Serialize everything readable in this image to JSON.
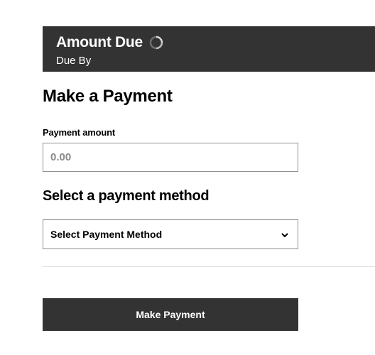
{
  "banner": {
    "title": "Amount Due",
    "subtitle": "Due By",
    "loading_icon": "spinner-icon"
  },
  "main": {
    "heading": "Make a Payment",
    "amount_label": "Payment amount",
    "amount_value": "",
    "amount_placeholder": "0.00",
    "method_heading": "Select a payment method",
    "method_select_value": "Select Payment Method",
    "method_select_icon": "chevron-down-icon",
    "submit_label": "Make Payment"
  },
  "colors": {
    "banner_bg": "#333333",
    "button_bg": "#333333",
    "input_border": "#8f8f8f",
    "placeholder": "#8a8a8a",
    "divider": "#e2e2e2"
  }
}
